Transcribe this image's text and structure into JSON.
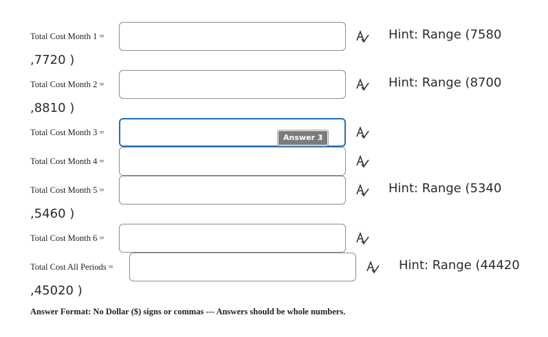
{
  "rows": [
    {
      "label": "Total Cost Month 1 =",
      "value": "",
      "hint": "Hint: Range (7580",
      "hint_cont": ",7720 )"
    },
    {
      "label": "Total Cost Month 2 =",
      "value": "",
      "hint": "Hint: Range (8700",
      "hint_cont": ",8810 )"
    },
    {
      "label": "Total Cost Month 3 =",
      "value": "",
      "tooltip": "Answer 3"
    },
    {
      "label": "Total Cost Month 4 =",
      "value": ""
    },
    {
      "label": "Total Cost Month 5 =",
      "value": "",
      "hint": "Hint: Range (5340",
      "hint_cont": ",5460 )"
    },
    {
      "label": "Total Cost Month 6 =",
      "value": ""
    },
    {
      "label": "Total Cost All Periods =",
      "value": "",
      "hint": "Hint: Range (44420",
      "hint_cont": ",45020 )"
    }
  ],
  "footer": "Answer Format: No Dollar ($) signs or commas --- Answers should be whole numbers.",
  "icons": {
    "spellcheck": "spellcheck-icon"
  },
  "colors": {
    "focus_border": "#1f6db3",
    "tooltip_bg": "#7b7b7b"
  }
}
